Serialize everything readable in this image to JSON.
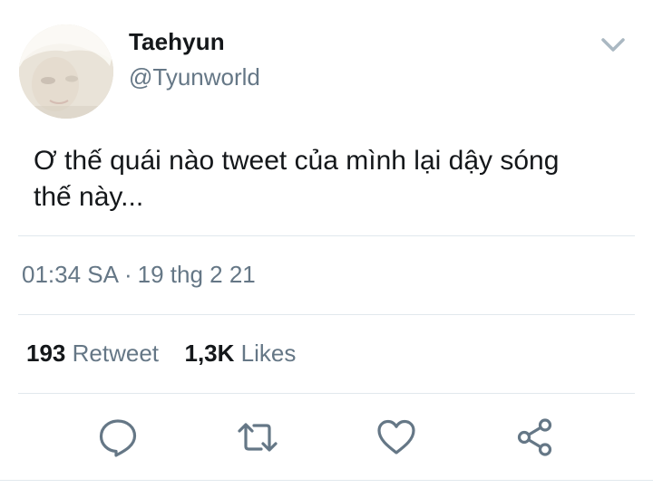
{
  "tweet": {
    "author": {
      "display_name": "Taehyun",
      "handle": "@Tyunworld"
    },
    "text_line1": "Ơ thế quái nào tweet của mình lại dậy sóng",
    "text_line2": "thế này...",
    "timestamp": {
      "time": "01:34 SA",
      "separator": "·",
      "date": "19 thg 2 21"
    },
    "stats": {
      "retweet_count": "193",
      "retweet_label": "Retweet",
      "likes_count": "1,3K",
      "likes_label": "Likes"
    },
    "actions": [
      {
        "icon": "reply-icon"
      },
      {
        "icon": "retweet-icon"
      },
      {
        "icon": "like-icon"
      },
      {
        "icon": "share-icon"
      }
    ],
    "menu_icon": "chevron-down-icon"
  },
  "colors": {
    "primary_text": "#14171a",
    "secondary_text": "#657786",
    "divider": "#e1e8ed"
  }
}
